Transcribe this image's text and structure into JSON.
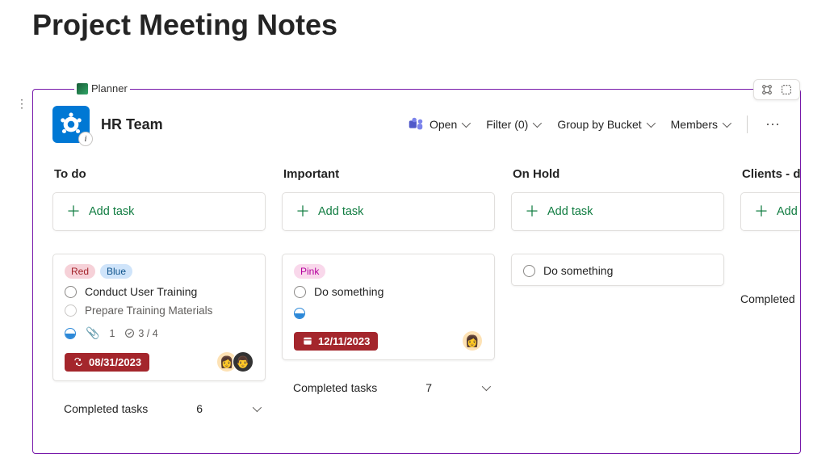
{
  "page_title": "Project Meeting Notes",
  "planner_label": "Planner",
  "plan_name": "HR Team",
  "header": {
    "open": "Open",
    "filter": "Filter (0)",
    "group": "Group by Bucket",
    "members": "Members"
  },
  "add_task_label": "Add task",
  "buckets": [
    {
      "name": "To do",
      "card": {
        "tags": [
          {
            "text": "Red",
            "cls": "tag-red"
          },
          {
            "text": "Blue",
            "cls": "tag-blue"
          }
        ],
        "title": "Conduct User Training",
        "subtask": "Prepare Training Materials",
        "attachment_count": "1",
        "checklist": "3 / 4",
        "date": "08/31/2023",
        "avatars": [
          "👩",
          "👨"
        ]
      },
      "completed": {
        "label": "Completed tasks",
        "count": "6"
      }
    },
    {
      "name": "Important",
      "card": {
        "tags": [
          {
            "text": "Pink",
            "cls": "tag-pink"
          }
        ],
        "title": "Do something",
        "date": "12/11/2023",
        "avatars": [
          "👩"
        ]
      },
      "completed": {
        "label": "Completed tasks",
        "count": "7"
      }
    },
    {
      "name": "On Hold",
      "card": {
        "title": "Do something"
      }
    },
    {
      "name": "Clients - do",
      "completed": {
        "label": "Completed"
      }
    }
  ]
}
